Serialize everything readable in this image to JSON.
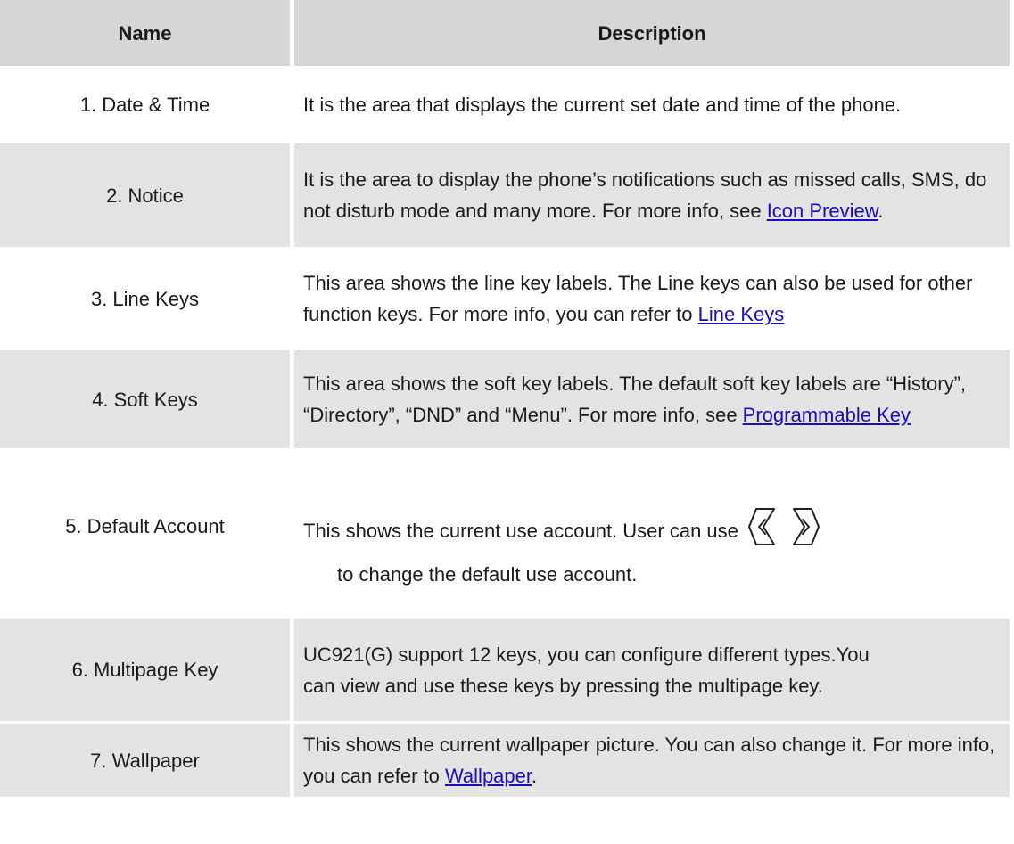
{
  "table": {
    "headers": {
      "name": "Name",
      "description": "Description"
    },
    "rows": [
      {
        "name": "1. Date & Time",
        "desc": "It is the area that displays the current set date and time of the phone."
      },
      {
        "name": "2. Notice",
        "desc_before": "It is the area to display the phone’s notifications such as missed calls, SMS, do not disturb mode and many more. For more info, see ",
        "link": "Icon Preview",
        "desc_after": "."
      },
      {
        "name": "3. Line Keys",
        "desc_before": "This area shows the line key labels. The Line keys can also be used for other function keys. For more info, you can refer to ",
        "link": "Line Keys"
      },
      {
        "name": "4. Soft Keys",
        "desc_before": "This area shows the soft key labels. The default soft key labels are “History”, “Directory”, “DND” and “Menu”. For more info, see ",
        "link": "Programmable Key"
      },
      {
        "name": "5. Default Account",
        "desc_line1": "This shows the current use account. User can use",
        "desc_line2": "to change the default use account.",
        "icons": [
          "left-arrow-key-icon",
          "right-arrow-key-icon"
        ]
      },
      {
        "name": "6. Multipage Key",
        "desc": "UC921(G) support 12 keys, you can configure different types.You can view and use these keys by pressing the multipage key."
      },
      {
        "name": "7. Wallpaper",
        "desc_before": "This shows the current wallpaper picture. You can also change it. For more info, you can refer to ",
        "link": "Wallpaper",
        "desc_after": "."
      }
    ]
  },
  "colors": {
    "header_bg": "#d6d6d6",
    "row_shaded_bg": "#e3e3e3",
    "link": "#1a0dbd"
  }
}
